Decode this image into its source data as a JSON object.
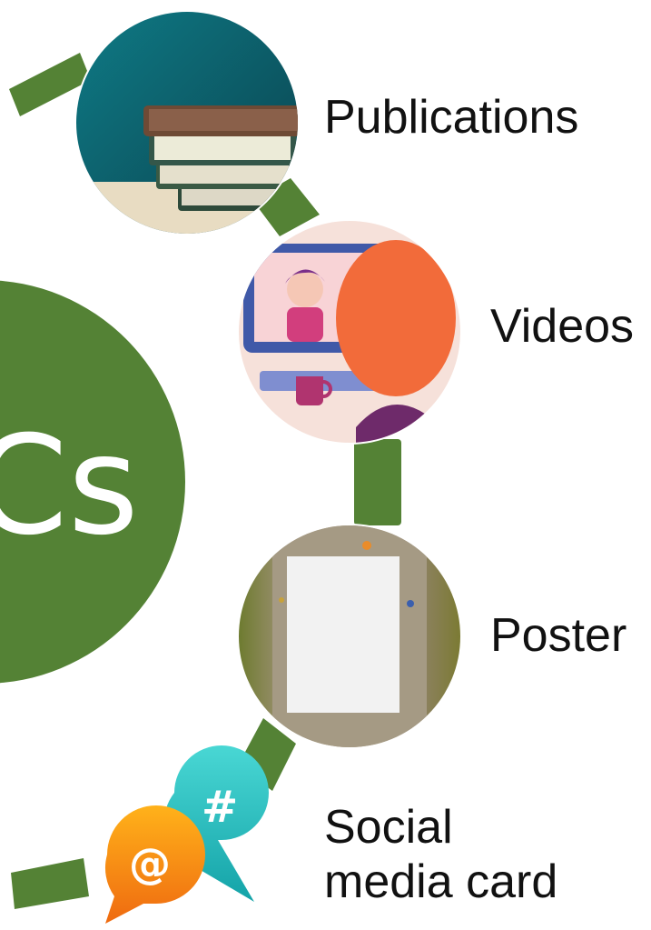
{
  "diagram": {
    "center_label": "Cs",
    "accent_color": "#548235",
    "items": [
      {
        "label": "Publications",
        "icon": "books-icon"
      },
      {
        "label": "Videos",
        "icon": "video-call-icon"
      },
      {
        "label": "Poster",
        "icon": "poster-icon"
      },
      {
        "label_line1": "Social",
        "label_line2": "media card",
        "icon": "social-media-bubbles-icon"
      }
    ]
  }
}
